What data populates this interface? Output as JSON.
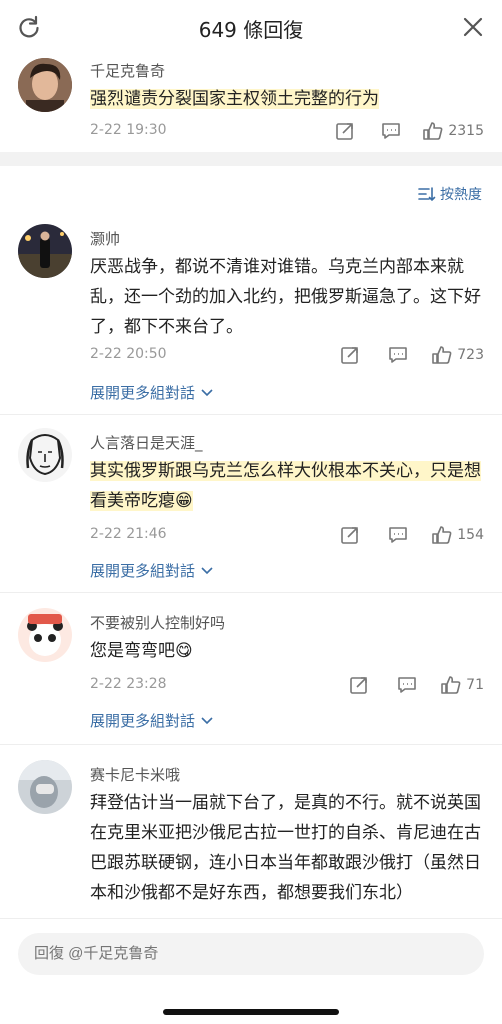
{
  "header": {
    "title": "649 條回復"
  },
  "pinned": {
    "username": "千足克鲁奇",
    "text": "强烈谴责分裂国家主权领土完整的行为",
    "time": "2-22 19:30",
    "likes": "2315"
  },
  "sort_label": "按熱度",
  "comments": [
    {
      "username": "灏帅",
      "text": "厌恶战争，都说不清谁对谁错。乌克兰内部本来就乱，还一个劲的加入北约，把俄罗斯逼急了。这下好了，都下不来台了。",
      "time": "2-22 20:50",
      "likes": "723",
      "expand": "展開更多組對話"
    },
    {
      "username": "人言落日是天涯_",
      "text": "其实俄罗斯跟乌克兰怎么样大伙根本不关心，只是想看美帝吃瘪😁",
      "time": "2-22 21:46",
      "likes": "154",
      "expand": "展開更多組對話"
    },
    {
      "username": "不要被别人控制好吗",
      "text": "您是弯弯吧😋",
      "time": "2-22 23:28",
      "likes": "71",
      "expand": "展開更多組對話"
    },
    {
      "username": "赛卡尼卡米哦",
      "text": "拜登估计当一届就下台了，是真的不行。就不说英国在克里米亚把沙俄尼古拉一世打的自杀、肯尼迪在古巴跟苏联硬钢，连小日本当年都敢跟沙俄打（虽然日本和沙俄都不是好东西，都想要我们东北）"
    }
  ],
  "reply": {
    "placeholder": "回復 @千足克鲁奇"
  },
  "colors": {
    "link": "#3b6ea5",
    "highlight": "#fff6c9",
    "band": "#f2f2f2"
  }
}
